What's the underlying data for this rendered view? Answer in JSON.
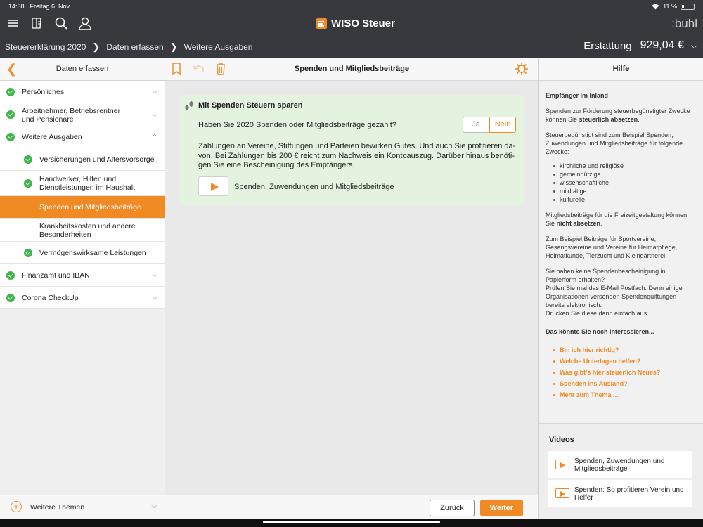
{
  "status": {
    "time": "14:38",
    "date": "Freitag 6. Nov.",
    "battery": "11 %"
  },
  "app": {
    "brand": "WISO Steuer",
    "vendor": ":buhl"
  },
  "breadcrumb": {
    "items": [
      "Steuererklärung 2020",
      "Daten erfassen",
      "Weitere Ausgaben"
    ],
    "refund_label": "Erstattung",
    "refund_amount": "929,04 €"
  },
  "sidebar": {
    "title": "Daten erfassen",
    "items": [
      {
        "label": "Persönliches"
      },
      {
        "label": "Arbeitnehmer, Betriebsrentner",
        "label2": "und Pensionäre"
      },
      {
        "label": "Weitere Ausgaben"
      },
      {
        "label": "Versicherungen und Altersvorsorge"
      },
      {
        "label": "Handwerker, Hilfen und",
        "label2": "Dienstleistungen im Haushalt"
      },
      {
        "label": "Spenden und Mitgliedsbeiträge"
      },
      {
        "label": "Krankheitskosten und andere",
        "label2": "Besonderheiten"
      },
      {
        "label": "Vermögenswirksame Leistungen"
      },
      {
        "label": "Finanzamt und IBAN"
      },
      {
        "label": "Corona CheckUp"
      }
    ],
    "footer": "Weitere Themen"
  },
  "main": {
    "title": "Spenden und Mitgliedsbeiträge",
    "card": {
      "heading": "Mit Spenden Steuern sparen",
      "question": "Haben Sie 2020 Spenden oder Mitgliedsbeiträge gezahlt?",
      "yes": "Ja",
      "no": "Nein",
      "selected": "Nein",
      "desc_lines": [
        "Zahlungen an Vereine, Stiftungen und Parteien bewirken Gutes. Und auch Sie profitieren da-",
        "von. Bei Zahlungen bis 200 € reicht zum Nachweis ein Kontoauszug. Darüber hinaus benöti-",
        "gen Sie eine Bescheinigung des Empfängers."
      ],
      "video_label": "Spenden, Zuwendungen und Mitgliedsbeiträge"
    },
    "back": "Zurück",
    "next": "Weiter"
  },
  "help": {
    "title": "Hilfe",
    "h1": "Empfänger im Inland",
    "p1a": "Spenden zur Förderung steuerbegünstigter Zwecke können Sie ",
    "p1b": "steuerlich absetzen",
    "p1c": ".",
    "p2": "Steuerbegünstigt sind zum Beispiel Spenden, Zuwendungen und Mitgliedsbeiträge für folgende Zwecke:",
    "list": [
      "kirchliche und religiöse",
      "gemeinnützige",
      "wissenschaftliche",
      "mildtätige",
      "kulturelle"
    ],
    "p3a": "Mitgliedsbeiträge für die Freizeitgestaltung können Sie ",
    "p3b": "nicht absetzen",
    "p3c": ".",
    "p4": "Zum Beispiel Beiträge für Sportvereine, Gesangsvereine und Vereine für Heimatpflege, Heimatkunde, Tierzucht und Kleingärtnerei.",
    "p5a": "Sie haben keine Spendenbescheinigung in Papierform erhalten?",
    "p5b": "Prüfen Sie mal das E-Mail Postfach. Denn einige Organisationen versenden Spendenquittungen bereits elektronisch.",
    "p5c": "Drucken Sie diese dann einfach aus.",
    "more_title": "Das könnte Sie noch interessieren...",
    "links": [
      "Bin ich hier richtig?",
      "Welche Unterlagen helfen?",
      "Was gibt's hier steuerlich Neues?",
      "Spenden ins Ausland?",
      "Mehr zum Thema ..."
    ],
    "videos_title": "Videos",
    "videos": [
      "Spenden, Zuwendungen und Mitgliedsbeiträge",
      "Spenden: So profitieren Verein und Helfer"
    ]
  },
  "colors": {
    "accent": "#f08a24",
    "check": "#3cb64a",
    "header": "#37393f",
    "card": "#e3f3df"
  }
}
